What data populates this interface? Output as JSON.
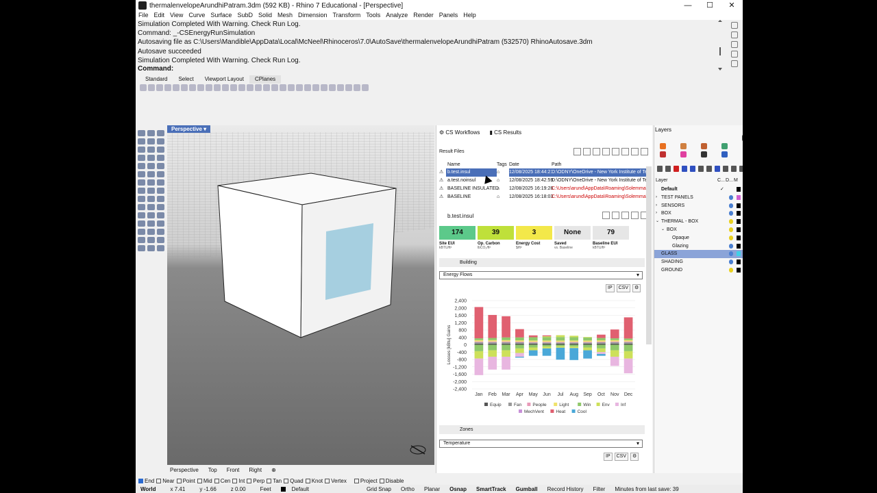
{
  "window": {
    "title": "thermalenvelopeArundhiPatram.3dm (592 KB) - Rhino 7 Educational - [Perspective]",
    "controls": [
      "—",
      "☐",
      "✕"
    ]
  },
  "menu": [
    "File",
    "Edit",
    "View",
    "Curve",
    "Surface",
    "SubD",
    "Solid",
    "Mesh",
    "Dimension",
    "Transform",
    "Tools",
    "Analyze",
    "Render",
    "Panels",
    "Help"
  ],
  "command_history": [
    "Simulation Completed With Warning. Check Run Log.",
    "Command: _-CSEnergyRunSimulation",
    "Autosaving file as C:\\Users\\Mandible\\AppData\\Local\\McNeel\\Rhinoceros\\7.0\\AutoSave\\thermalenvelopeArundhiPatram (532570) RhinoAutosave.3dm",
    "Autosave succeeded",
    "Simulation Completed With Warning. Check Run Log."
  ],
  "command_prompt": "Command:",
  "toolbar_tabs": [
    "Standard",
    "Select",
    "Viewport Layout",
    "CPlanes"
  ],
  "viewport": {
    "label": "Perspective",
    "tabs": [
      "Perspective",
      "Top",
      "Front",
      "Right"
    ],
    "add_tab": "⊕"
  },
  "cs": {
    "tabs": [
      "CS Workflows",
      "CS Results"
    ],
    "result_files_title": "Result Files",
    "columns": [
      "Name",
      "Tags",
      "Date",
      "Path"
    ],
    "rows": [
      {
        "name": "b.test.insul",
        "date": "12/08/2025 18:44:21",
        "path": "D:\\ODNY\\OneDrive - New York Institute of Tech",
        "selected": true,
        "red": false
      },
      {
        "name": "a.test.noinsul",
        "date": "12/08/2025 18:42:59",
        "path": "D:\\ODNY\\OneDrive - New York Institute of Tech",
        "selected": false,
        "red": false
      },
      {
        "name": "BASELINE INSULATED",
        "date": "12/08/2025 16:19:28",
        "path": "C:\\Users\\arund\\AppData\\Roaming\\Solemma\\Cl",
        "selected": false,
        "red": true
      },
      {
        "name": "BASELINE",
        "date": "12/08/2025 16:18:03",
        "path": "C:\\Users\\arund\\AppData\\Roaming\\Solemma\\Cl",
        "selected": false,
        "red": true
      }
    ],
    "file_title": "b.test.insul",
    "metrics": [
      {
        "value": "174",
        "label": "Site EUI",
        "unit": "kBTU/ft²",
        "color": "#5cc98a"
      },
      {
        "value": "39",
        "label": "Op. Carbon",
        "unit": "lbCO₂/ft²",
        "color": "#bfe03a"
      },
      {
        "value": "3",
        "label": "Energy Cost",
        "unit": "$/ft²",
        "color": "#f3e84a"
      },
      {
        "value": "None",
        "label": "Saved",
        "unit": "vs. Baseline",
        "color": "#e6e6e6"
      },
      {
        "value": "79",
        "label": "Baseline EUI",
        "unit": "kBTU/ft²",
        "color": "#e6e6e6"
      }
    ],
    "building_section": "Building",
    "building_dropdown": "Energy Flows",
    "ip": "IP",
    "csv": "CSV",
    "zones_section": "Zones",
    "zones_dropdown": "Temperature"
  },
  "chart_data": {
    "type": "bar",
    "stacked": true,
    "title": "",
    "ylabel": "Losses [kBtu]  Gains",
    "ylim": [
      -2400,
      2400
    ],
    "yticks": [
      "2,400",
      "2,000",
      "1,600",
      "1,200",
      "800",
      "400",
      "0",
      "-400",
      "-800",
      "-1,200",
      "-1,600",
      "-2,000",
      "-2,400"
    ],
    "categories": [
      "Jan",
      "Feb",
      "Mar",
      "Apr",
      "May",
      "Jun",
      "Jul",
      "Aug",
      "Sep",
      "Oct",
      "Nov",
      "Dec"
    ],
    "series": [
      {
        "name": "Equip",
        "color": "#555555",
        "values": [
          60,
          60,
          60,
          60,
          60,
          60,
          60,
          60,
          60,
          60,
          60,
          60
        ]
      },
      {
        "name": "Fan",
        "color": "#999999",
        "values": [
          80,
          80,
          80,
          70,
          60,
          60,
          60,
          60,
          60,
          70,
          80,
          80
        ]
      },
      {
        "name": "People",
        "color": "#e89ab8",
        "values": [
          40,
          40,
          40,
          40,
          40,
          40,
          40,
          40,
          40,
          40,
          40,
          40
        ]
      },
      {
        "name": "Light",
        "color": "#f0e26a",
        "values": [
          70,
          70,
          70,
          70,
          70,
          70,
          70,
          70,
          70,
          70,
          70,
          70
        ]
      },
      {
        "name": "Win",
        "color": "#8fc86a",
        "values": [
          100,
          120,
          150,
          160,
          180,
          180,
          190,
          180,
          160,
          130,
          100,
          90
        ]
      },
      {
        "name": "Env",
        "color": "#cde05a",
        "values": [
          0,
          0,
          0,
          0,
          0,
          50,
          100,
          80,
          30,
          0,
          0,
          0
        ]
      },
      {
        "name": "Inf",
        "color": "#e8b6e0",
        "values": [
          0,
          0,
          0,
          0,
          0,
          0,
          0,
          0,
          0,
          0,
          0,
          0
        ]
      },
      {
        "name": "MechVent",
        "color": "#c890d8",
        "values": [
          0,
          0,
          0,
          0,
          0,
          0,
          0,
          0,
          0,
          0,
          0,
          0
        ]
      },
      {
        "name": "Heat",
        "color": "#e06070",
        "values": [
          1700,
          1250,
          1150,
          450,
          100,
          50,
          0,
          0,
          0,
          180,
          480,
          1150
        ]
      },
      {
        "name": "Cool",
        "color": "#4aa8d8",
        "values": [
          0,
          0,
          0,
          0,
          0,
          0,
          0,
          0,
          0,
          0,
          0,
          0
        ]
      }
    ],
    "losses": [
      {
        "name": "Win",
        "color": "#8fc86a",
        "values": [
          -350,
          -300,
          -300,
          -200,
          -150,
          -100,
          -80,
          -100,
          -150,
          -200,
          -300,
          -350
        ]
      },
      {
        "name": "Env",
        "color": "#cde05a",
        "values": [
          -400,
          -350,
          -350,
          -250,
          -150,
          -100,
          -80,
          -80,
          -150,
          -200,
          -350,
          -400
        ]
      },
      {
        "name": "Inf",
        "color": "#e8b6e0",
        "values": [
          -900,
          -700,
          -700,
          -200,
          0,
          0,
          0,
          0,
          0,
          -100,
          -500,
          -800
        ]
      },
      {
        "name": "Cool",
        "color": "#4aa8d8",
        "values": [
          0,
          0,
          0,
          -50,
          -300,
          -400,
          -650,
          -650,
          -450,
          -100,
          0,
          0
        ]
      }
    ],
    "legend": [
      "Equip",
      "Fan",
      "People",
      "Light",
      "Win",
      "Env",
      "Inf",
      "MechVent",
      "Heat",
      "Cool"
    ]
  },
  "layers": {
    "title": "Layers",
    "header": {
      "layer": "Layer",
      "c": "C...",
      "d": "D...",
      "m": "M"
    },
    "rows": [
      {
        "name": "Default",
        "indent": 0,
        "bold": true,
        "bulb": "",
        "color": "#000000",
        "check": "✓"
      },
      {
        "name": "TEST PANELS",
        "indent": 0,
        "bulb": "#4a7fd0",
        "color": "#d060d0"
      },
      {
        "name": "SENSORS",
        "indent": 0,
        "bulb": "#4a7fd0",
        "color": "#000000"
      },
      {
        "name": "BOX",
        "indent": 0,
        "bulb": "#4a7fd0",
        "color": "#000000"
      },
      {
        "name": "THERMAL - BOX",
        "indent": 0,
        "bulb": "#e8d020",
        "color": "#000000"
      },
      {
        "name": "BOX",
        "indent": 1,
        "bulb": "#e8d020",
        "color": "#000000"
      },
      {
        "name": "Opaque",
        "indent": 2,
        "bulb": "#e8d020",
        "color": "#000000"
      },
      {
        "name": "Glazing",
        "indent": 2,
        "bulb": "#4a7fd0",
        "color": "#000000"
      },
      {
        "name": "GLASS",
        "indent": 0,
        "bulb": "#4a7fd0",
        "color": "#40d0e8",
        "selected": true
      },
      {
        "name": "SHADING",
        "indent": 0,
        "bulb": "#4a7fd0",
        "color": "#000000"
      },
      {
        "name": "GROUND",
        "indent": 0,
        "bulb": "#e8d020",
        "color": "#000000"
      }
    ]
  },
  "osnaps": [
    {
      "label": "End",
      "on": true
    },
    {
      "label": "Near",
      "on": false
    },
    {
      "label": "Point",
      "on": false
    },
    {
      "label": "Mid",
      "on": false
    },
    {
      "label": "Cen",
      "on": false
    },
    {
      "label": "Int",
      "on": false
    },
    {
      "label": "Perp",
      "on": false
    },
    {
      "label": "Tan",
      "on": false
    },
    {
      "label": "Quad",
      "on": false
    },
    {
      "label": "Knot",
      "on": false
    },
    {
      "label": "Vertex",
      "on": false
    },
    {
      "label": "Project",
      "on": false
    },
    {
      "label": "Disable",
      "on": false
    }
  ],
  "status": {
    "world": "World",
    "x": "x 7.41",
    "y": "y -1.66",
    "z": "z 0.00",
    "units": "Feet",
    "layer": "Default",
    "grid_snap": "Grid Snap",
    "ortho": "Ortho",
    "planar": "Planar",
    "osnap": "Osnap",
    "smarttrack": "SmartTrack",
    "gumball": "Gumball",
    "history": "Record History",
    "filter": "Filter",
    "autosave": "Minutes from last save: 39"
  }
}
